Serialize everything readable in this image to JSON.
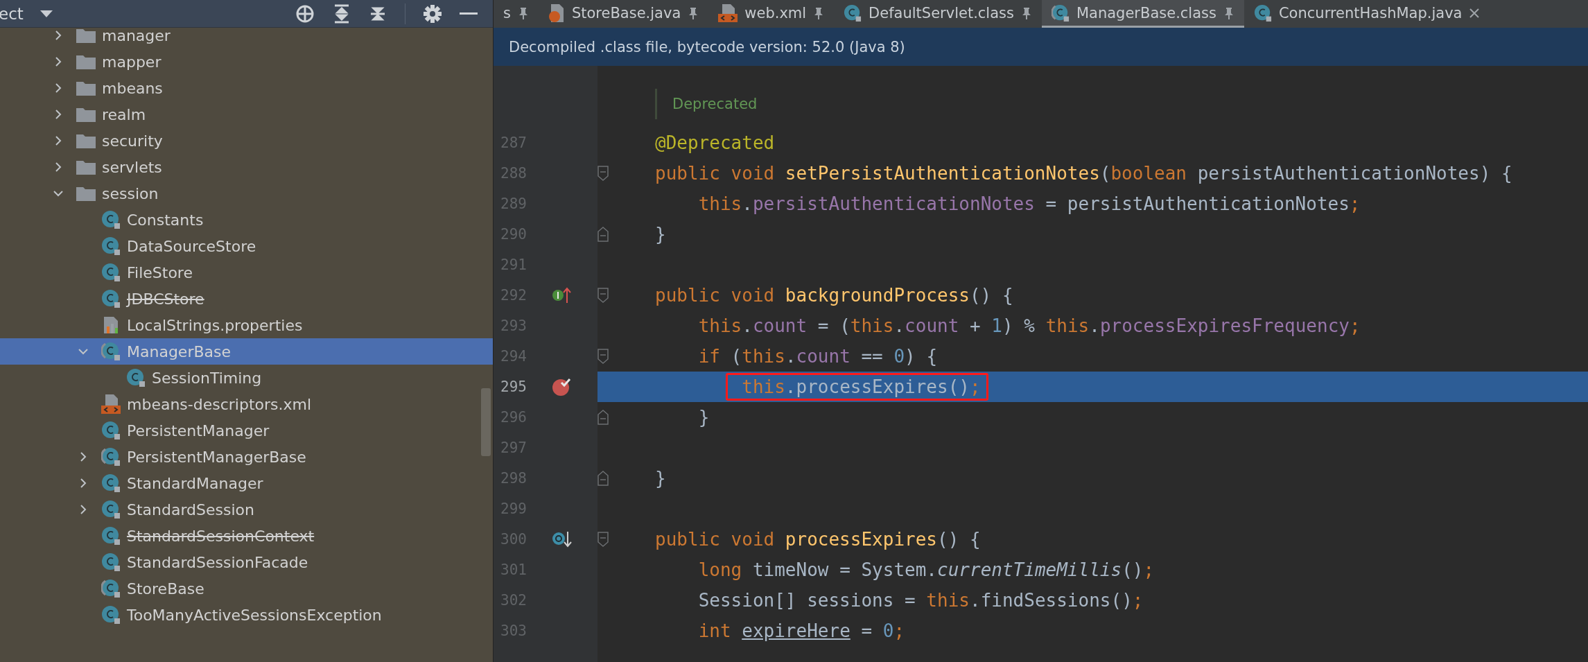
{
  "project_panel": {
    "title": "ect"
  },
  "tree": [
    {
      "label": "manager",
      "kind": "folder",
      "expandable": true,
      "expanded": false,
      "selected": false,
      "deprecated": false
    },
    {
      "label": "mapper",
      "kind": "folder",
      "expandable": true,
      "expanded": false,
      "selected": false,
      "deprecated": false
    },
    {
      "label": "mbeans",
      "kind": "folder",
      "expandable": true,
      "expanded": false,
      "selected": false,
      "deprecated": false
    },
    {
      "label": "realm",
      "kind": "folder",
      "expandable": true,
      "expanded": false,
      "selected": false,
      "deprecated": false
    },
    {
      "label": "security",
      "kind": "folder",
      "expandable": true,
      "expanded": false,
      "selected": false,
      "deprecated": false
    },
    {
      "label": "servlets",
      "kind": "folder",
      "expandable": true,
      "expanded": false,
      "selected": false,
      "deprecated": false
    },
    {
      "label": "session",
      "kind": "folder",
      "expandable": true,
      "expanded": true,
      "selected": false,
      "deprecated": false,
      "children": [
        {
          "label": "Constants",
          "kind": "class",
          "expandable": false,
          "selected": false,
          "deprecated": false
        },
        {
          "label": "DataSourceStore",
          "kind": "class",
          "expandable": false,
          "selected": false,
          "deprecated": false
        },
        {
          "label": "FileStore",
          "kind": "class",
          "expandable": false,
          "selected": false,
          "deprecated": false
        },
        {
          "label": "JDBCStore",
          "kind": "class",
          "expandable": false,
          "selected": false,
          "deprecated": true
        },
        {
          "label": "LocalStrings.properties",
          "kind": "properties",
          "expandable": false,
          "selected": false,
          "deprecated": false
        },
        {
          "label": "ManagerBase",
          "kind": "abstract-class",
          "expandable": true,
          "expanded": true,
          "selected": true,
          "deprecated": false,
          "children": [
            {
              "label": "SessionTiming",
              "kind": "class",
              "expandable": false,
              "selected": false,
              "deprecated": false
            }
          ]
        },
        {
          "label": "mbeans-descriptors.xml",
          "kind": "xml",
          "expandable": false,
          "selected": false,
          "deprecated": false
        },
        {
          "label": "PersistentManager",
          "kind": "class",
          "expandable": false,
          "selected": false,
          "deprecated": false
        },
        {
          "label": "PersistentManagerBase",
          "kind": "abstract-class",
          "expandable": true,
          "expanded": false,
          "selected": false,
          "deprecated": false
        },
        {
          "label": "StandardManager",
          "kind": "class",
          "expandable": true,
          "expanded": false,
          "selected": false,
          "deprecated": false
        },
        {
          "label": "StandardSession",
          "kind": "class",
          "expandable": true,
          "expanded": false,
          "selected": false,
          "deprecated": false
        },
        {
          "label": "StandardSessionContext",
          "kind": "class",
          "expandable": false,
          "selected": false,
          "deprecated": true
        },
        {
          "label": "StandardSessionFacade",
          "kind": "class",
          "expandable": false,
          "selected": false,
          "deprecated": false
        },
        {
          "label": "StoreBase",
          "kind": "abstract-class",
          "expandable": false,
          "selected": false,
          "deprecated": false
        },
        {
          "label": "TooManyActiveSessionsException",
          "kind": "class",
          "expandable": false,
          "selected": false,
          "deprecated": false
        }
      ]
    }
  ],
  "tabs": [
    {
      "label": "s",
      "pinned": true,
      "selected": false
    },
    {
      "label": "StoreBase.java",
      "kind": "java",
      "pinned": true,
      "selected": false
    },
    {
      "label": "web.xml",
      "kind": "xml",
      "pinned": true,
      "selected": false
    },
    {
      "label": "DefaultServlet.class",
      "kind": "class",
      "pinned": true,
      "selected": false
    },
    {
      "label": "ManagerBase.class",
      "kind": "abstract-class",
      "pinned": true,
      "selected": true
    },
    {
      "label": "ConcurrentHashMap.java",
      "kind": "class",
      "pinned": false,
      "selected": false
    }
  ],
  "info_bar": {
    "text": "Decompiled .class file, bytecode version: 52.0 (Java 8)"
  },
  "editor": {
    "doc_comment": "Deprecated",
    "lines": [
      {
        "number": "287",
        "current": false,
        "boxed": false,
        "tokens": [
          {
            "kind": "ann",
            "text": "@Deprecated"
          }
        ]
      },
      {
        "number": "288",
        "gutter": [
          {
            "kind": "fold-start"
          }
        ],
        "current": false,
        "boxed": false,
        "tokens": [
          {
            "kind": "kw",
            "text": "public void "
          },
          {
            "kind": "fn",
            "text": "setPersistAuthenticationNotes"
          },
          {
            "kind": "plain",
            "text": "("
          },
          {
            "kind": "kw",
            "text": "boolean "
          },
          {
            "kind": "plain",
            "text": "persistAuthenticationNotes) {"
          }
        ]
      },
      {
        "number": "289",
        "current": false,
        "boxed": false,
        "tokens": [
          {
            "kind": "kw",
            "text": "    this"
          },
          {
            "kind": "plain",
            "text": "."
          },
          {
            "kind": "field",
            "text": "persistAuthenticationNotes"
          },
          {
            "kind": "plain",
            "text": " = persistAuthenticationNotes"
          },
          {
            "kind": "kw",
            "text": ";"
          }
        ]
      },
      {
        "number": "290",
        "gutter": [
          {
            "kind": "fold-end"
          }
        ],
        "current": false,
        "boxed": false,
        "tokens": [
          {
            "kind": "plain",
            "text": "}"
          }
        ]
      },
      {
        "number": "291",
        "current": false,
        "boxed": false
      },
      {
        "number": "292",
        "gutter": [
          {
            "kind": "implements"
          },
          {
            "kind": "fold-start"
          }
        ],
        "current": false,
        "boxed": false,
        "tokens": [
          {
            "kind": "kw",
            "text": "public void "
          },
          {
            "kind": "fn",
            "text": "backgroundProcess"
          },
          {
            "kind": "plain",
            "text": "() {"
          }
        ]
      },
      {
        "number": "293",
        "current": false,
        "boxed": false,
        "tokens": [
          {
            "kind": "kw",
            "text": "    this"
          },
          {
            "kind": "plain",
            "text": "."
          },
          {
            "kind": "field",
            "text": "count"
          },
          {
            "kind": "plain",
            "text": " = ("
          },
          {
            "kind": "kw",
            "text": "this"
          },
          {
            "kind": "plain",
            "text": "."
          },
          {
            "kind": "field",
            "text": "count"
          },
          {
            "kind": "plain",
            "text": " + "
          },
          {
            "kind": "num",
            "text": "1"
          },
          {
            "kind": "plain",
            "text": ") % "
          },
          {
            "kind": "kw",
            "text": "this"
          },
          {
            "kind": "plain",
            "text": "."
          },
          {
            "kind": "field",
            "text": "processExpiresFrequency"
          },
          {
            "kind": "kw",
            "text": ";"
          }
        ]
      },
      {
        "number": "294",
        "gutter": [
          {
            "kind": "fold-start"
          }
        ],
        "current": false,
        "boxed": false,
        "tokens": [
          {
            "kind": "kw",
            "text": "    if "
          },
          {
            "kind": "plain",
            "text": "("
          },
          {
            "kind": "kw",
            "text": "this"
          },
          {
            "kind": "plain",
            "text": "."
          },
          {
            "kind": "field",
            "text": "count"
          },
          {
            "kind": "plain",
            "text": " == "
          },
          {
            "kind": "num",
            "text": "0"
          },
          {
            "kind": "plain",
            "text": ") {"
          }
        ]
      },
      {
        "number": "295",
        "gutter": [
          {
            "kind": "breakpoint"
          }
        ],
        "current": true,
        "boxed": true,
        "tokens": [
          {
            "kind": "kw",
            "text": "        this"
          },
          {
            "kind": "plain",
            "text": ".processExpires()"
          },
          {
            "kind": "kw",
            "text": ";"
          }
        ]
      },
      {
        "number": "296",
        "gutter": [
          {
            "kind": "fold-end"
          }
        ],
        "current": false,
        "boxed": false,
        "tokens": [
          {
            "kind": "plain",
            "text": "    }"
          }
        ]
      },
      {
        "number": "297",
        "current": false,
        "boxed": false
      },
      {
        "number": "298",
        "gutter": [
          {
            "kind": "fold-end"
          }
        ],
        "current": false,
        "boxed": false,
        "tokens": [
          {
            "kind": "plain",
            "text": "}"
          }
        ]
      },
      {
        "number": "299",
        "current": false,
        "boxed": false
      },
      {
        "number": "300",
        "gutter": [
          {
            "kind": "implemented"
          },
          {
            "kind": "fold-start"
          }
        ],
        "current": false,
        "boxed": false,
        "tokens": [
          {
            "kind": "kw",
            "text": "public void "
          },
          {
            "kind": "fn",
            "text": "processExpires"
          },
          {
            "kind": "plain",
            "text": "() {"
          }
        ]
      },
      {
        "number": "301",
        "current": false,
        "boxed": false,
        "tokens": [
          {
            "kind": "kw",
            "text": "    long "
          },
          {
            "kind": "plain",
            "text": "timeNow = System."
          },
          {
            "kind": "italic",
            "text": "currentTimeMillis"
          },
          {
            "kind": "plain",
            "text": "()"
          },
          {
            "kind": "kw",
            "text": ";"
          }
        ]
      },
      {
        "number": "302",
        "current": false,
        "boxed": false,
        "tokens": [
          {
            "kind": "plain",
            "text": "    Session[] sessions = "
          },
          {
            "kind": "kw",
            "text": "this"
          },
          {
            "kind": "plain",
            "text": ".findSessions()"
          },
          {
            "kind": "kw",
            "text": ";"
          }
        ]
      },
      {
        "number": "303",
        "current": false,
        "boxed": false,
        "tokens": [
          {
            "kind": "kw",
            "text": "    int "
          },
          {
            "kind": "under",
            "text": "expireHere"
          },
          {
            "kind": "plain",
            "text": " = "
          },
          {
            "kind": "num",
            "text": "0"
          },
          {
            "kind": "kw",
            "text": ";"
          }
        ]
      }
    ]
  }
}
